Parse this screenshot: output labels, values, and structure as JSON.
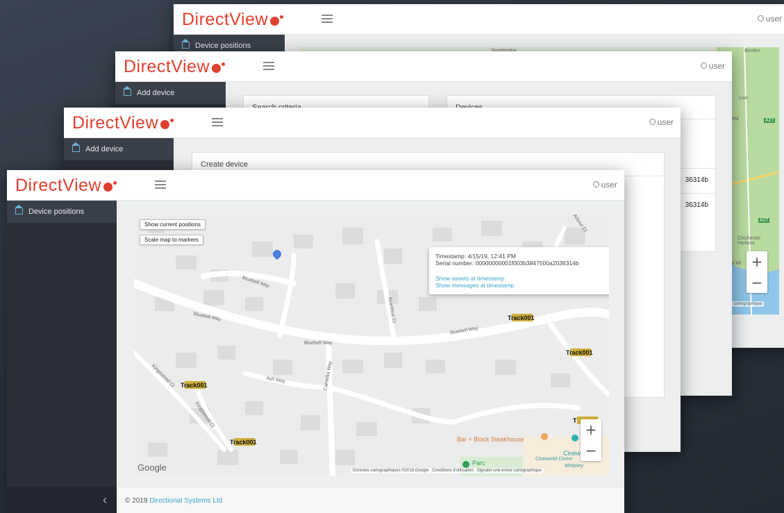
{
  "brand": {
    "name": "DirectView",
    "accent": "#e0402f",
    "link": "#3aa4c9"
  },
  "user_label": "user",
  "windows": {
    "w1": {
      "nav_item": "Device positions",
      "map_labels": {
        "town1": "Stockbridge",
        "town2": "Borden",
        "town3": "Lise",
        "town4": "eld",
        "town5": "Chichester Harbour",
        "town6": "st Wi",
        "road1": "A27",
        "road2": "A27"
      },
      "attribution": "cartographique"
    },
    "w2": {
      "nav_item": "Add device",
      "panel_left_title": "Search criteria",
      "panel_right_title": "Devices",
      "rows": [
        "36314b",
        "36314b"
      ]
    },
    "w3": {
      "nav_item": "Add device",
      "panel_title": "Create device"
    },
    "w4": {
      "nav_item": "Device positions",
      "buttons": {
        "show_positions": "Show current positions",
        "scale_map": "Scale map to markers"
      },
      "streets": [
        "Bluebell Way",
        "Bluebell Way",
        "Bluebell Way",
        "Bluebell Way",
        "Acanthus Ct",
        "Camellia Way",
        "Ash Way",
        "Kingswood Ct",
        "Kingswood Ct",
        "Arbour Ct"
      ],
      "markers": [
        "Track001",
        "Track001",
        "Track001",
        "Track001",
        "T"
      ],
      "tooltip": {
        "timestamp": "Timestamp: 4/15/19, 12:41 PM",
        "serial": "Serial number: 00000000001f003b3847500a2036314b",
        "link1": "Show assets at timestamp",
        "link2": "Show messages at timestamp"
      },
      "pois": {
        "restaurant": "Bar + Block Steakhouse",
        "cinema": "Cinéw",
        "cinema2": "Cineworld Cinem",
        "park": "Parc",
        "cinema3": "Whiteley"
      },
      "google": "Google",
      "attribution": {
        "data": "Données cartographiques ©2019 Google",
        "terms": "Conditions d'utilisation",
        "report": "Signaler une erreur cartographique"
      },
      "footer": {
        "prefix": "© 2019",
        "company": "Directional Systems Ltd"
      },
      "collapse_icon": "‹"
    }
  }
}
